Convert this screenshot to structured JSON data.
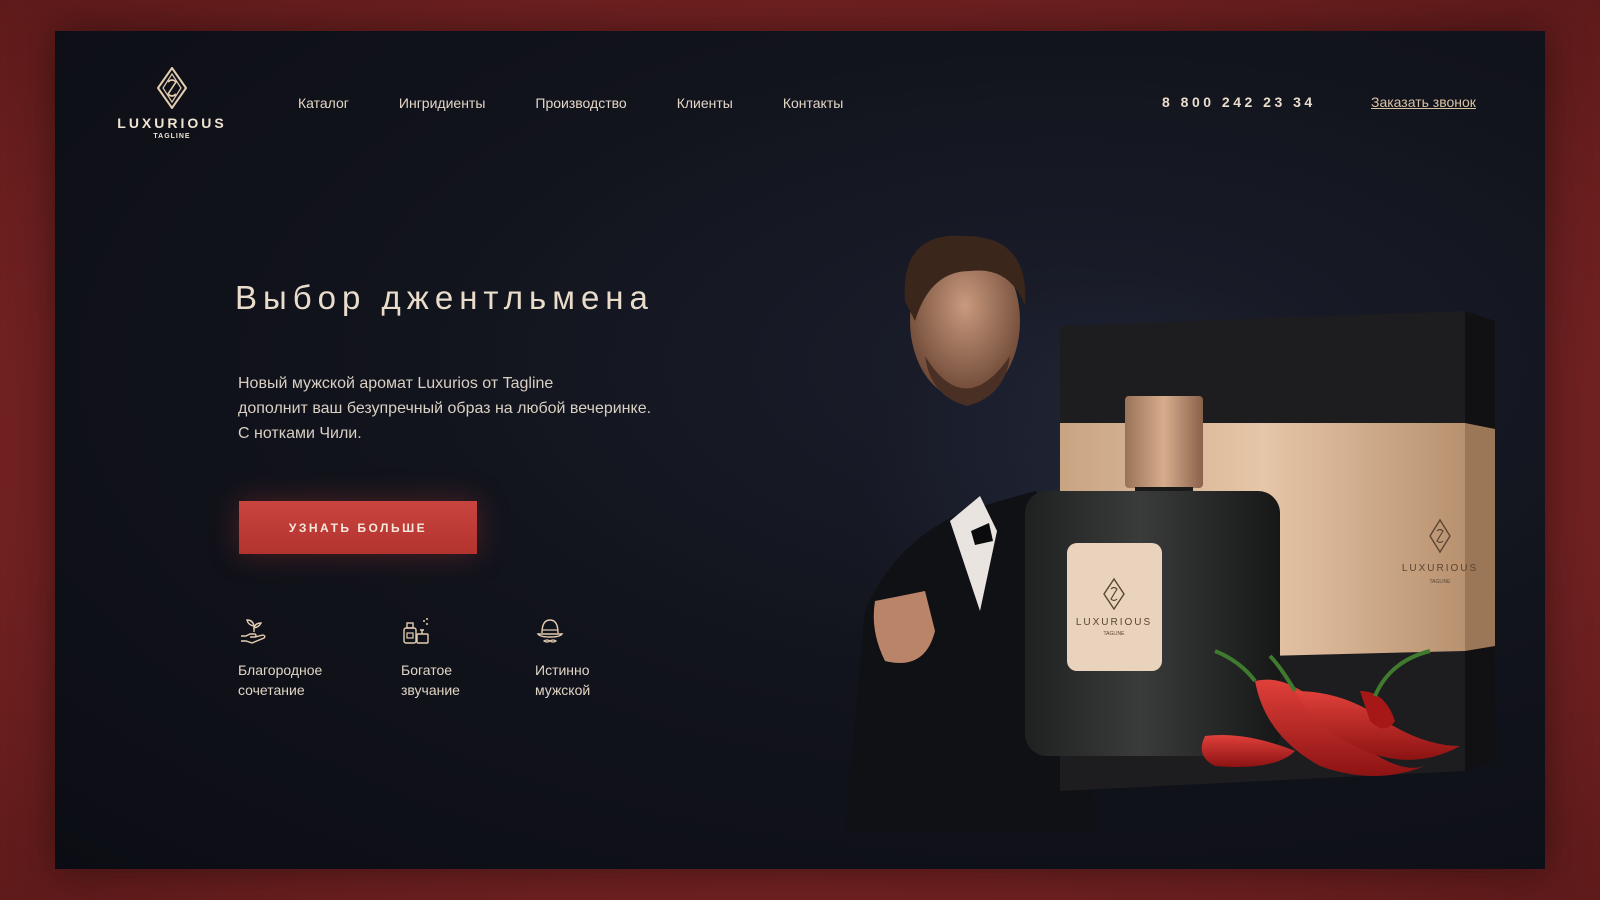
{
  "brand": {
    "name": "LUXURIOUS",
    "tagline": "TAGLINE"
  },
  "nav": {
    "items": [
      "Каталог",
      "Ингридиенты",
      "Производство",
      "Клиенты",
      "Контакты"
    ]
  },
  "header": {
    "phone": "8 800 242 23 34",
    "callback_label": "Заказать звонок"
  },
  "hero": {
    "title": "Выбор джентльмена",
    "description_lines": [
      "Новый мужской аромат Luxurios от Tagline",
      "дополнит ваш безупречный образ на любой вечеринке.",
      "С нотками Чили."
    ],
    "cta_label": "УЗНАТЬ БОЛЬШЕ"
  },
  "features": [
    {
      "icon": "hand-leaves-icon",
      "line1": "Благородное",
      "line2": "сочетание"
    },
    {
      "icon": "perfume-bottle-icon",
      "line1": "Богатое",
      "line2": "звучание"
    },
    {
      "icon": "gentleman-hat-icon",
      "line1": "Истинно",
      "line2": "мужской"
    }
  ],
  "product": {
    "bottle_label": "LUXURIOUS",
    "bottle_tagline": "TAGLINE",
    "box_label": "LUXURIOUS",
    "box_tagline": "TAGLINE"
  },
  "colors": {
    "accent": "#c0403b",
    "gold": "#d9b48f",
    "background": "#12141d",
    "frame": "#7a2424"
  }
}
